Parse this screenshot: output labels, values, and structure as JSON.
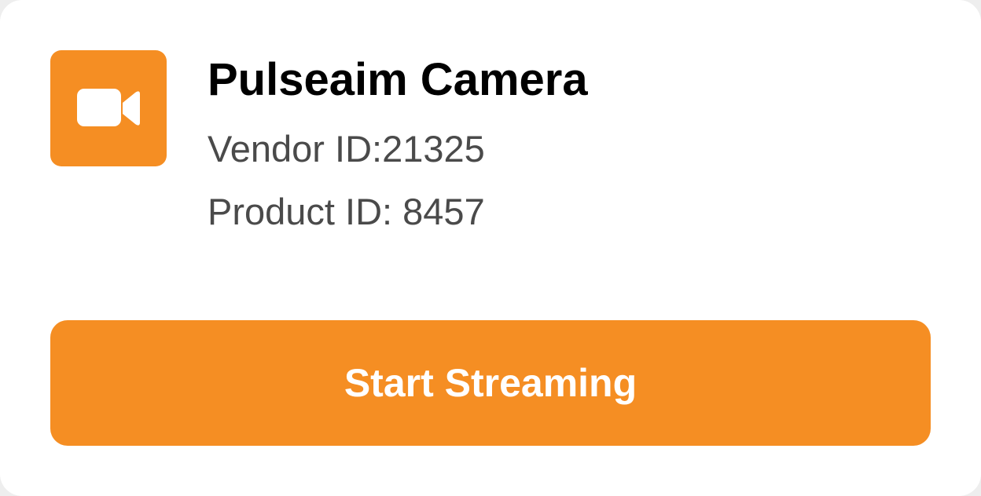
{
  "device": {
    "name": "Pulseaim Camera",
    "vendor_id_text": "Vendor ID:21325",
    "product_id_text": "Product ID: 8457",
    "icon": "video-camera-icon"
  },
  "actions": {
    "start_label": "Start Streaming"
  },
  "colors": {
    "accent": "#f58e23",
    "title": "#000000",
    "meta": "#4a4a4a",
    "card_background": "#ffffff"
  }
}
